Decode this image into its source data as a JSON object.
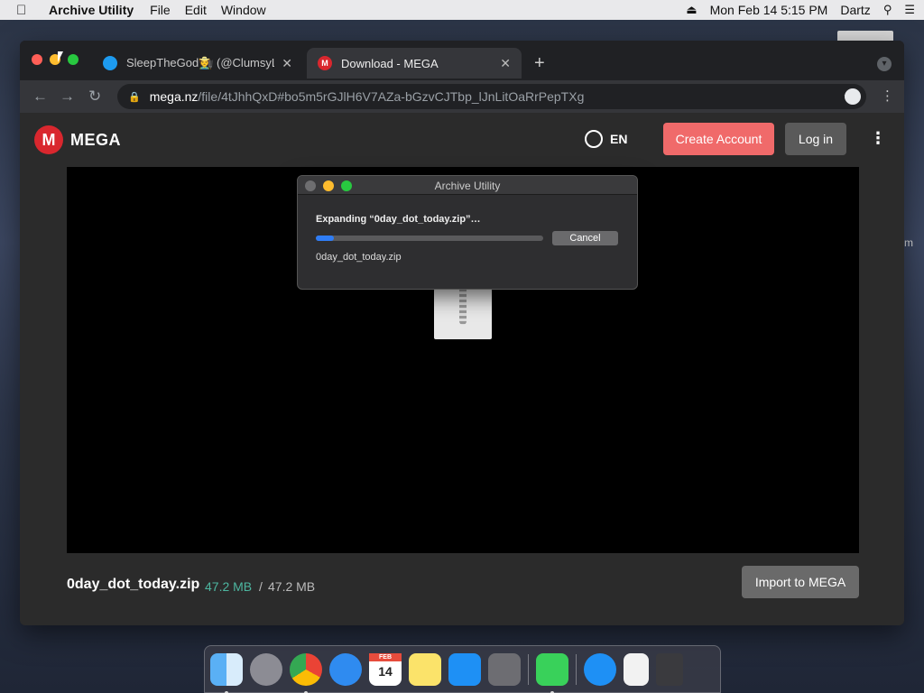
{
  "menubar": {
    "app_name": "Archive Utility",
    "menus": [
      "File",
      "Edit",
      "Window"
    ],
    "datetime": "Mon Feb 14  5:15 PM",
    "user": "Dartz"
  },
  "browser": {
    "tabs": [
      {
        "title": "SleepTheGod🧑‍🌾 (@ClumsyLul",
        "favicon": "twitter-icon"
      },
      {
        "title": "Download - MEGA",
        "favicon": "mega-icon",
        "active": true
      }
    ],
    "url": {
      "host": "mega.nz",
      "path": "/file/4tJhhQxD#bo5m5rGJlH6V7AZa-bGzvCJTbp_lJnLitOaRrPepTXg"
    }
  },
  "mega": {
    "logo": "MEGA",
    "logo_letter": "M",
    "language": "EN",
    "create_account": "Create Account",
    "login": "Log in",
    "file": {
      "name": "0day_dot_today.zip",
      "downloaded": "47.2 MB",
      "separator": "/",
      "total": "47.2 MB"
    },
    "import_button": "Import to MEGA"
  },
  "dialog": {
    "title": "Archive Utility",
    "message": "Expanding “0day_dot_today.zip”…",
    "progress_percent": 8,
    "cancel": "Cancel",
    "file": "0day_dot_today.zip"
  },
  "dock": {
    "calendar_month": "FEB",
    "calendar_day": "14",
    "apps": [
      "finder",
      "launchpad",
      "chrome",
      "safari",
      "calendar",
      "notes",
      "app-store",
      "system-preferences",
      "archive-utility",
      "app-store-downloads",
      "zip-document",
      "trash"
    ]
  },
  "colors": {
    "mega_red": "#d9272e",
    "create_account": "#f06a6a",
    "progress": "#2f7df6",
    "size_done": "#4db6a0"
  }
}
